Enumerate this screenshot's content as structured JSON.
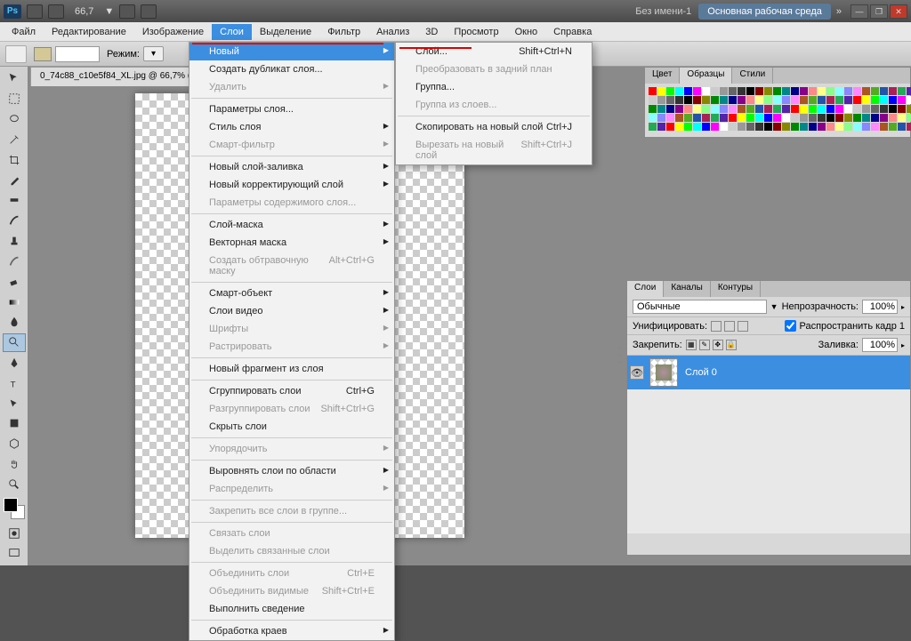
{
  "titlebar": {
    "logo": "Ps",
    "zoom": "66,7",
    "doc_untitled": "Без имени-1",
    "workspace": "Основная рабочая среда"
  },
  "menubar": {
    "items": [
      "Файл",
      "Редактирование",
      "Изображение",
      "Слои",
      "Выделение",
      "Фильтр",
      "Анализ",
      "3D",
      "Просмотр",
      "Окно",
      "Справка"
    ]
  },
  "doc_tab": "0_74c88_c10e5f84_XL.jpg @ 66,7% (Сло",
  "optbar": {
    "mode_label": "Режим:"
  },
  "layers_menu": {
    "items": [
      {
        "label": "Новый",
        "arrow": true,
        "hl": true
      },
      {
        "label": "Создать дубликат слоя..."
      },
      {
        "label": "Удалить",
        "arrow": true,
        "dis": true
      },
      {
        "sep": true
      },
      {
        "label": "Параметры слоя..."
      },
      {
        "label": "Стиль слоя",
        "arrow": true
      },
      {
        "label": "Смарт-фильтр",
        "arrow": true,
        "dis": true
      },
      {
        "sep": true
      },
      {
        "label": "Новый слой-заливка",
        "arrow": true
      },
      {
        "label": "Новый корректирующий слой",
        "arrow": true
      },
      {
        "label": "Параметры содержимого слоя...",
        "dis": true
      },
      {
        "sep": true
      },
      {
        "label": "Слой-маска",
        "arrow": true
      },
      {
        "label": "Векторная маска",
        "arrow": true
      },
      {
        "label": "Создать обтравочную маску",
        "shortcut": "Alt+Ctrl+G",
        "dis": true
      },
      {
        "sep": true
      },
      {
        "label": "Смарт-объект",
        "arrow": true
      },
      {
        "label": "Слои видео",
        "arrow": true
      },
      {
        "label": "Шрифты",
        "arrow": true,
        "dis": true
      },
      {
        "label": "Растрировать",
        "arrow": true,
        "dis": true
      },
      {
        "sep": true
      },
      {
        "label": "Новый фрагмент из слоя"
      },
      {
        "sep": true
      },
      {
        "label": "Сгруппировать слои",
        "shortcut": "Ctrl+G"
      },
      {
        "label": "Разгруппировать слои",
        "shortcut": "Shift+Ctrl+G",
        "dis": true
      },
      {
        "label": "Скрыть слои"
      },
      {
        "sep": true
      },
      {
        "label": "Упорядочить",
        "arrow": true,
        "dis": true
      },
      {
        "sep": true
      },
      {
        "label": "Выровнять слои по области",
        "arrow": true
      },
      {
        "label": "Распределить",
        "arrow": true,
        "dis": true
      },
      {
        "sep": true
      },
      {
        "label": "Закрепить все слои в группе...",
        "dis": true
      },
      {
        "sep": true
      },
      {
        "label": "Связать слои",
        "dis": true
      },
      {
        "label": "Выделить связанные слои",
        "dis": true
      },
      {
        "sep": true
      },
      {
        "label": "Объединить слои",
        "shortcut": "Ctrl+E",
        "dis": true
      },
      {
        "label": "Объединить видимые",
        "shortcut": "Shift+Ctrl+E",
        "dis": true
      },
      {
        "label": "Выполнить сведение"
      },
      {
        "sep": true
      },
      {
        "label": "Обработка краев",
        "arrow": true
      }
    ]
  },
  "new_submenu": {
    "items": [
      {
        "label": "Слой...",
        "shortcut": "Shift+Ctrl+N"
      },
      {
        "label": "Преобразовать в задний план",
        "dis": true
      },
      {
        "label": "Группа..."
      },
      {
        "label": "Группа из слоев...",
        "dis": true
      },
      {
        "sep": true
      },
      {
        "label": "Скопировать на новый слой",
        "shortcut": "Ctrl+J"
      },
      {
        "label": "Вырезать на новый слой",
        "shortcut": "Shift+Ctrl+J",
        "dis": true
      }
    ]
  },
  "color_panel": {
    "tabs": [
      "Цвет",
      "Образцы",
      "Стили"
    ]
  },
  "layers_panel": {
    "tabs": [
      "Слои",
      "Каналы",
      "Контуры"
    ],
    "blend": "Обычные",
    "opacity_label": "Непрозрачность:",
    "opacity": "100%",
    "unify_label": "Унифицировать:",
    "propagate": "Распространить кадр 1",
    "lock_label": "Закрепить:",
    "fill_label": "Заливка:",
    "fill": "100%",
    "layer0": "Слой 0"
  }
}
